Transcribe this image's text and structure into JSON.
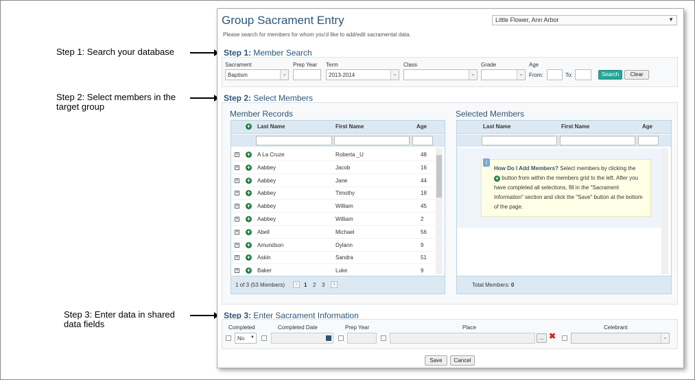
{
  "annotations": {
    "step1": "Step 1: Search your database",
    "step2_line1": "Step 2: Select members in the",
    "step2_line2": "target group",
    "step3_line1": "Step 3: Enter data in shared",
    "step3_line2": "data fields"
  },
  "window": {
    "title": "Group Sacrament Entry",
    "parish": "Little Flower, Ann Arbor",
    "intro": "Please search for members for whom you'd like to add/edit sacramental data."
  },
  "step1": {
    "num": "Step 1:",
    "title": "Member Search",
    "labels": {
      "sacrament": "Sacrament",
      "prep_year": "Prep Year",
      "term": "Term",
      "class": "Class",
      "grade": "Grade",
      "age": "Age",
      "from": "From:",
      "to": "To:"
    },
    "values": {
      "sacrament": "Baptism",
      "prep_year": "",
      "term": "2013-2014",
      "class": "",
      "grade": "",
      "age_from": "",
      "age_to": ""
    },
    "search_label": "Search",
    "clear_label": "Clear"
  },
  "step2": {
    "num": "Step 2:",
    "title": "Select Members",
    "records_title": "Member Records",
    "selected_title": "Selected Members",
    "columns": {
      "last": "Last Name",
      "first": "First Name",
      "age": "Age"
    },
    "rows": [
      {
        "last": "A La Cruze",
        "first": "Roberta _U",
        "age": "48"
      },
      {
        "last": "Aabbey",
        "first": "Jacob",
        "age": "16"
      },
      {
        "last": "Aabbey",
        "first": "Jane",
        "age": "44"
      },
      {
        "last": "Aabbey",
        "first": "Timothy",
        "age": "18"
      },
      {
        "last": "Aabbey",
        "first": "William",
        "age": "45"
      },
      {
        "last": "Aabbey",
        "first": "William",
        "age": "2"
      },
      {
        "last": "Abell",
        "first": "Michael",
        "age": "56"
      },
      {
        "last": "Amundson",
        "first": "Dylann",
        "age": "9"
      },
      {
        "last": "Askin",
        "first": "Sandra",
        "age": "51"
      },
      {
        "last": "Baker",
        "first": "Luke",
        "age": "9"
      }
    ],
    "pager_info": "1 of 3 (53 Members)",
    "pages": [
      "1",
      "2",
      "3"
    ],
    "help_title": "How Do I Add Members?",
    "help_text_a": " Select members by clicking the",
    "help_text_b": "button from within the members grid to the left. After you have completed all selections, fill in the \"Sacrament Information\" section and click the \"Save\" button at the bottom of the page.",
    "total_label": "Total Members:",
    "total_value": "0"
  },
  "step3": {
    "num": "Step 3:",
    "title": "Enter Sacrament Information",
    "labels": {
      "completed": "Completed",
      "completed_date": "Completed Date",
      "prep_year": "Prep Year",
      "place": "Place",
      "celebrant": "Celebrant"
    },
    "completed_value": "No",
    "place_browse": "..."
  },
  "footer": {
    "save": "Save",
    "cancel": "Cancel"
  }
}
